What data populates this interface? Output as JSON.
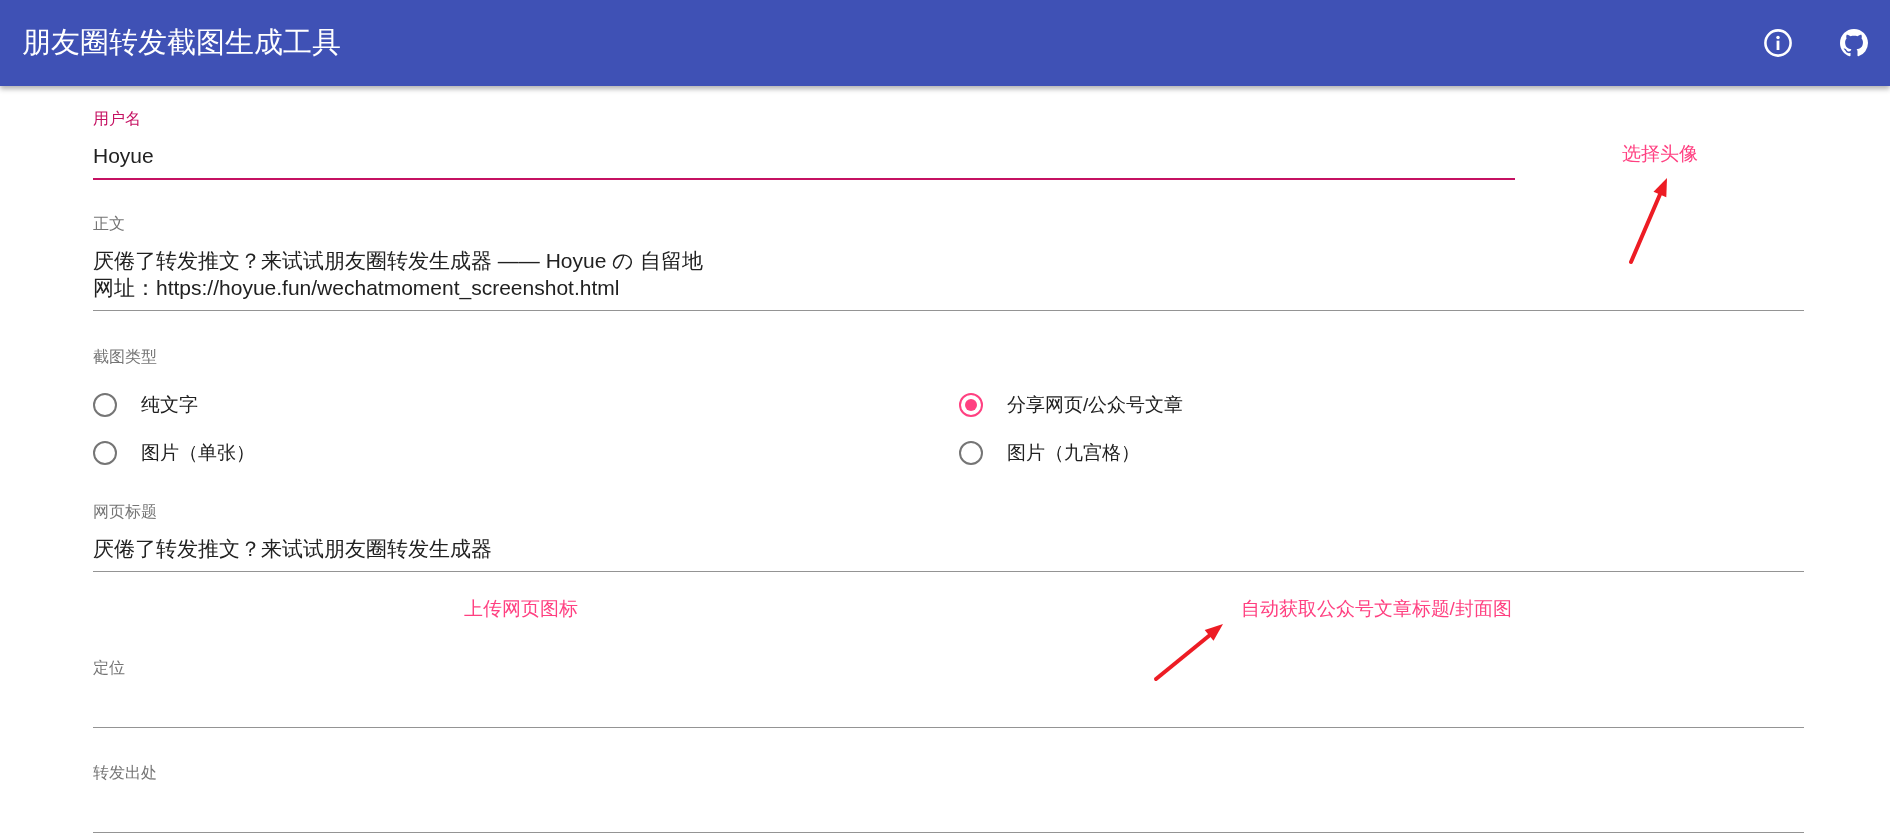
{
  "app_bar": {
    "title": "朋友圈转发截图生成工具"
  },
  "username": {
    "label": "用户名",
    "value": "Hoyue",
    "focused": true
  },
  "avatar_link": "选择头像",
  "body": {
    "label": "正文",
    "lines": [
      "厌倦了转发推文？来试试朋友圈转发生成器 —— Hoyue の 自留地",
      "网址：https://hoyue.fun/wechatmoment_screenshot.html"
    ],
    "focused": false
  },
  "screenshot_type": {
    "label": "截图类型",
    "options": [
      {
        "label": "纯文字",
        "selected": false
      },
      {
        "label": "分享网页/公众号文章",
        "selected": true
      },
      {
        "label": "图片（单张）",
        "selected": false
      },
      {
        "label": "图片（九宫格）",
        "selected": false
      }
    ]
  },
  "page_title": {
    "label": "网页标题",
    "value": "厌倦了转发推文？来试试朋友圈转发生成器",
    "focused": false
  },
  "links": [
    "上传网页图标",
    "自动获取公众号文章标题/封面图"
  ],
  "location": {
    "label": "定位",
    "focused": false
  },
  "forward_source": {
    "label": "转发出处",
    "focused": false
  }
}
